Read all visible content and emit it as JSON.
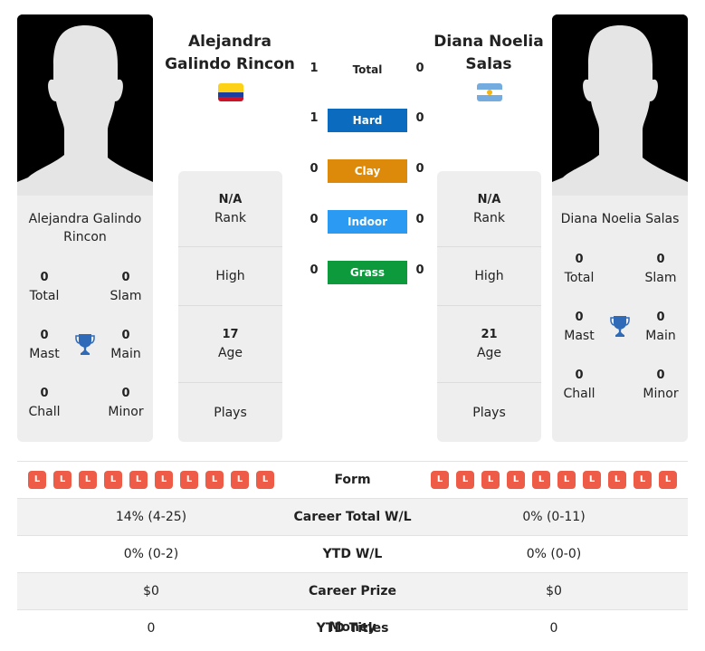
{
  "players": {
    "left": {
      "name": "Alejandra Galindo Rincon",
      "name_line1": "Alejandra",
      "name_line2": "Galindo Rincon",
      "card_name_line1": "Alejandra Galindo",
      "card_name_line2": "Rincon",
      "country_flag": "colombia-flag",
      "rank": "N/A",
      "rank_label": "Rank",
      "high_label": "High",
      "age": "17",
      "age_label": "Age",
      "plays_label": "Plays",
      "titles": {
        "total": "0",
        "total_label": "Total",
        "slam": "0",
        "slam_label": "Slam",
        "mast": "0",
        "mast_label": "Mast",
        "main": "0",
        "main_label": "Main",
        "chall": "0",
        "chall_label": "Chall",
        "minor": "0",
        "minor_label": "Minor"
      },
      "form": [
        "L",
        "L",
        "L",
        "L",
        "L",
        "L",
        "L",
        "L",
        "L",
        "L"
      ],
      "career_total_wl": "14% (4-25)",
      "ytd_wl": "0% (0-2)",
      "career_prize_money": "$0",
      "ytd_titles": "0"
    },
    "right": {
      "name": "Diana Noelia Salas",
      "name_line1": "Diana Noelia",
      "name_line2": "Salas",
      "card_name_line1": "Diana Noelia Salas",
      "country_flag": "argentina-flag",
      "rank": "N/A",
      "rank_label": "Rank",
      "high_label": "High",
      "age": "21",
      "age_label": "Age",
      "plays_label": "Plays",
      "titles": {
        "total": "0",
        "total_label": "Total",
        "slam": "0",
        "slam_label": "Slam",
        "mast": "0",
        "mast_label": "Mast",
        "main": "0",
        "main_label": "Main",
        "chall": "0",
        "chall_label": "Chall",
        "minor": "0",
        "minor_label": "Minor"
      },
      "form": [
        "L",
        "L",
        "L",
        "L",
        "L",
        "L",
        "L",
        "L",
        "L",
        "L"
      ],
      "career_total_wl": "0% (0-11)",
      "ytd_wl": "0% (0-0)",
      "career_prize_money": "$0",
      "ytd_titles": "0"
    }
  },
  "h2h": {
    "total": {
      "label": "Total",
      "left": "1",
      "right": "0"
    },
    "surfaces": [
      {
        "label": "Hard",
        "left": "1",
        "right": "0",
        "color": "#0a6bbf"
      },
      {
        "label": "Clay",
        "left": "0",
        "right": "0",
        "color": "#dd8a0b"
      },
      {
        "label": "Indoor",
        "left": "0",
        "right": "0",
        "color": "#2b9af3"
      },
      {
        "label": "Grass",
        "left": "0",
        "right": "0",
        "color": "#0c9a3c"
      }
    ]
  },
  "stats_labels": {
    "form": "Form",
    "career_total_wl": "Career Total W/L",
    "ytd_wl": "YTD W/L",
    "career_prize_money": "Career Prize Money",
    "ytd_titles": "YTD Titles"
  },
  "colors": {
    "loss_badge": "#ee5b46",
    "trophy": "#2f6ab8",
    "card_bg": "#eeeeee"
  }
}
